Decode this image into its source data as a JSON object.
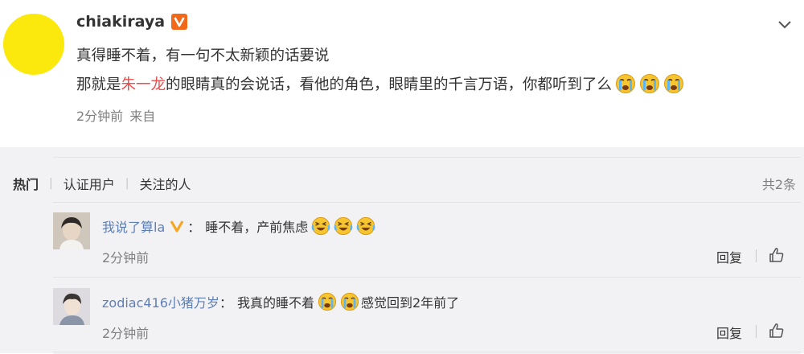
{
  "post": {
    "username": "chiakiraya",
    "line1": "真得睡不着，有一句不太新颖的话要说",
    "line2_before": "那就是",
    "line2_highlight": "朱一龙",
    "line2_after": "的眼睛真的会说话，看他的角色，眼睛里的千言万语，你都听到了么",
    "time": "2分钟前",
    "source": "来自"
  },
  "comments_section": {
    "tabs": [
      "热门",
      "认证用户",
      "关注的人"
    ],
    "count_label": "共2条",
    "comments": [
      {
        "username": "我说了算la",
        "colon": "：",
        "text_before": "睡不着，产前焦虑",
        "text_after": "",
        "time": "2分钟前",
        "reply_label": "回复"
      },
      {
        "username": "zodiac416小猪万岁",
        "colon": "：",
        "text_before": "我真的睡不着",
        "text_after": "感觉回到2年前了",
        "time": "2分钟前",
        "reply_label": "回复"
      }
    ]
  },
  "icons": {
    "verified_badge": "verified-v-icon",
    "expand": "chevron-down-icon",
    "like": "thumbs-up-icon",
    "emoji_cry": "crying-face-icon",
    "emoji_laugh_cry": "laughing-crying-face-icon"
  },
  "colors": {
    "highlight": "#eb4c4c",
    "username_link": "#5d7fb6",
    "avatar_yellow": "#fbe80c",
    "badge_orange": "#f26a19",
    "comment_bg": "#f2f2f5"
  }
}
